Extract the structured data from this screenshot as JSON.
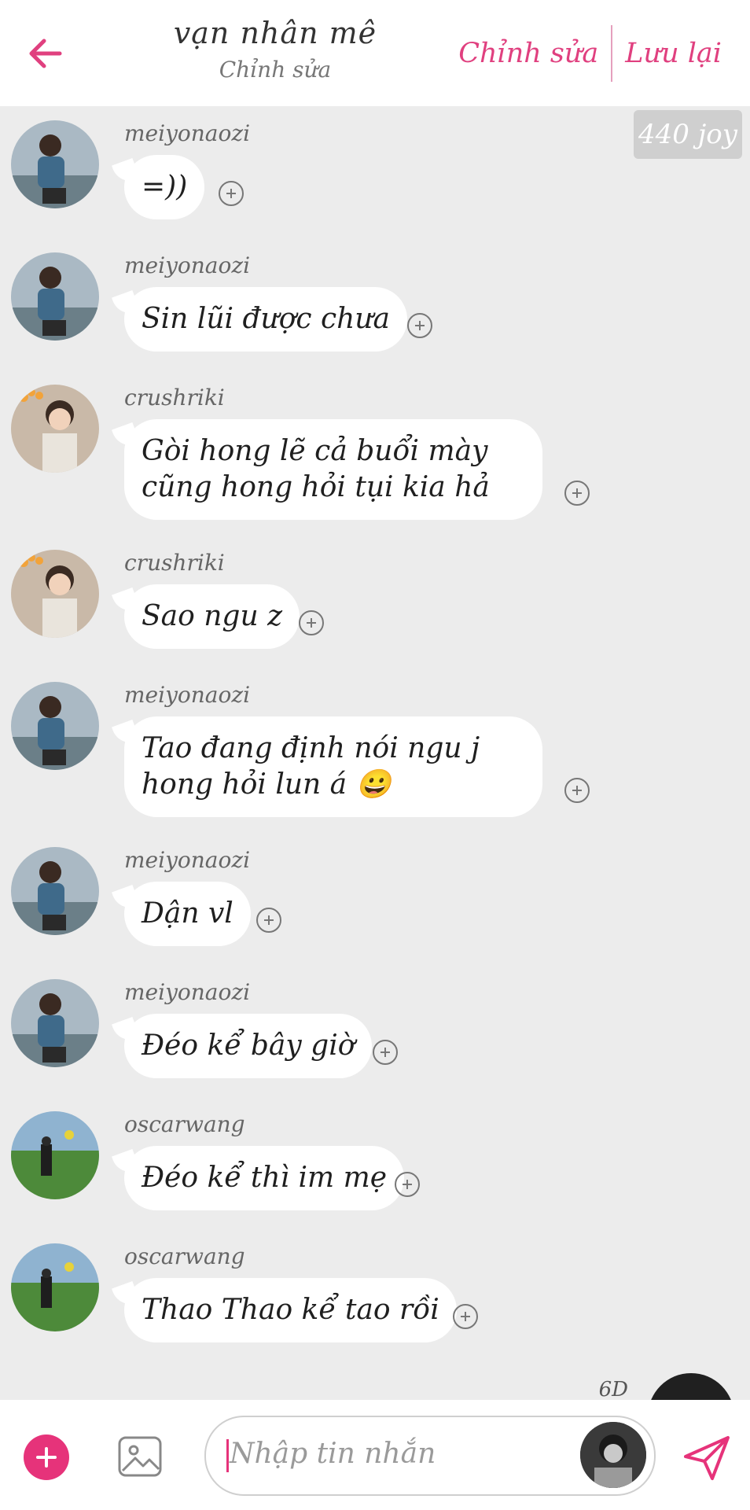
{
  "header": {
    "title": "vạn nhân mê",
    "subtitle": "Chỉnh sửa",
    "edit_label": "Chỉnh sửa",
    "save_label": "Lưu lại"
  },
  "joy_badge": "440 joy",
  "messages": [
    {
      "user": "meiyonaozi",
      "text": "=))"
    },
    {
      "user": "meiyonaozi",
      "text": "Sin lũi được chưa"
    },
    {
      "user": "crushriki",
      "text": "Gòi hong lẽ cả buổi mày cũng hong hỏi tụi kia hả"
    },
    {
      "user": "crushriki",
      "text": "Sao ngu z"
    },
    {
      "user": "meiyonaozi",
      "text": "Tao đang định nói ngu j hong hỏi lun á 😀"
    },
    {
      "user": "meiyonaozi",
      "text": "Dận vl"
    },
    {
      "user": "meiyonaozi",
      "text": "Đéo kể bây giờ"
    },
    {
      "user": "oscarwang",
      "text": "Đéo kể thì im mẹ"
    },
    {
      "user": "oscarwang",
      "text": "Thao Thao kể tao rồi"
    }
  ],
  "peek_label": "6D",
  "composer": {
    "placeholder": "Nhập tin nhắn"
  },
  "colors": {
    "accent": "#e6337a",
    "header_link": "#e0407f",
    "background": "#ececec"
  }
}
